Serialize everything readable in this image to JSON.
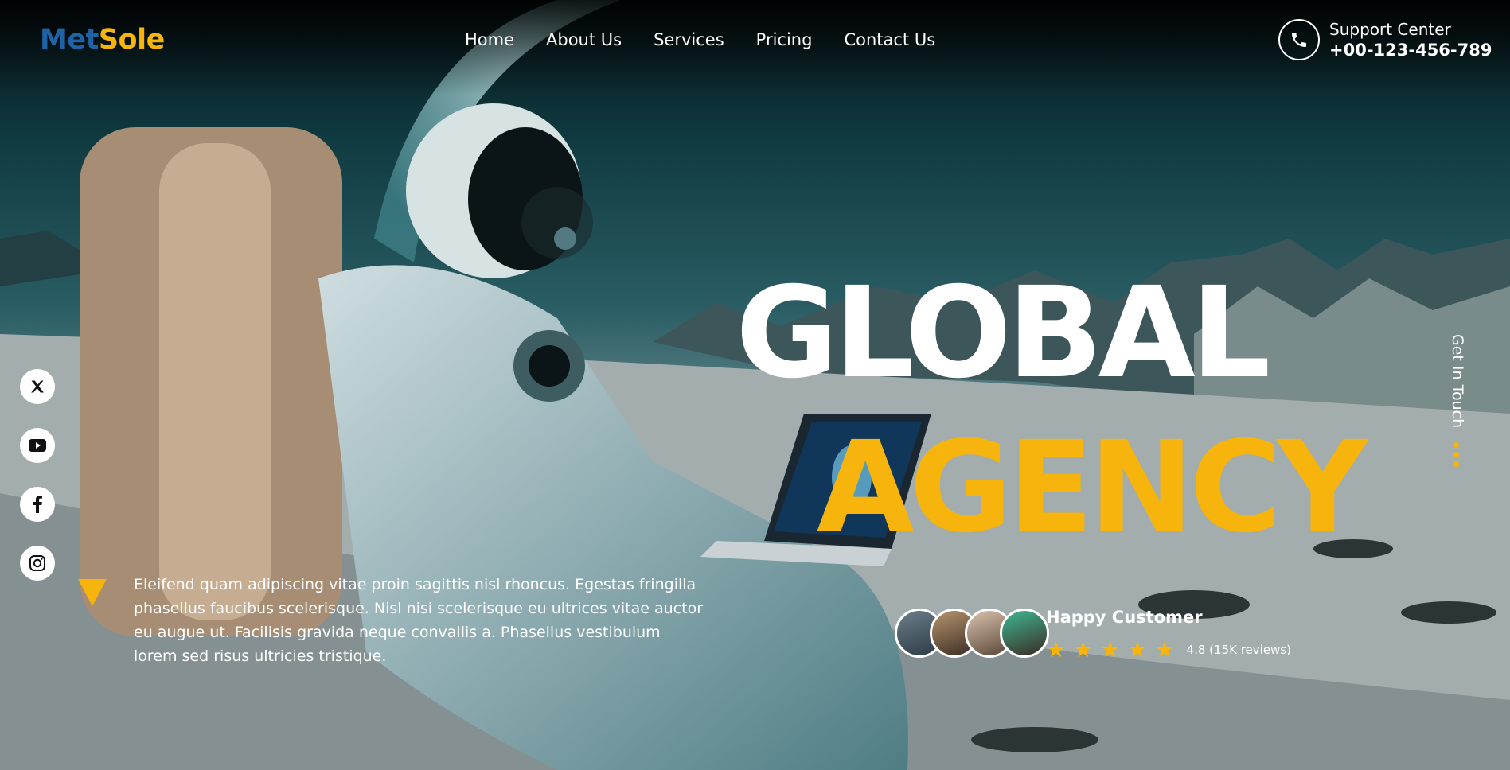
{
  "logo": {
    "part1": "Met",
    "part2": "Sole"
  },
  "nav": {
    "items": [
      "Home",
      "About Us",
      "Services",
      "Pricing",
      "Contact Us"
    ]
  },
  "support": {
    "label": "Support Center",
    "phone": "+00-123-456-789",
    "icon": "phone-icon"
  },
  "social": {
    "icons": [
      "x-icon",
      "youtube-icon",
      "facebook-icon",
      "instagram-icon"
    ]
  },
  "hero": {
    "headline_1": "GLOBAL",
    "headline_2": "AGENCY",
    "paragraph": "Eleifend quam adipiscing vitae proin sagittis nisl rhoncus. Egestas fringilla phasellus faucibus scelerisque. Nisl nisi scelerisque eu ultrices vitae auctor eu augue ut. Facilisis gravida neque convallis a. Phasellus vestibulum lorem sed risus ultricies tristique."
  },
  "customers": {
    "title": "Happy Customer",
    "stars": 5,
    "rating_text": "4.8 (15K reviews)"
  },
  "side": {
    "get_in_touch": "Get In Touch"
  },
  "colors": {
    "accent": "#f6b40c",
    "logo_blue": "#1e63a8"
  }
}
